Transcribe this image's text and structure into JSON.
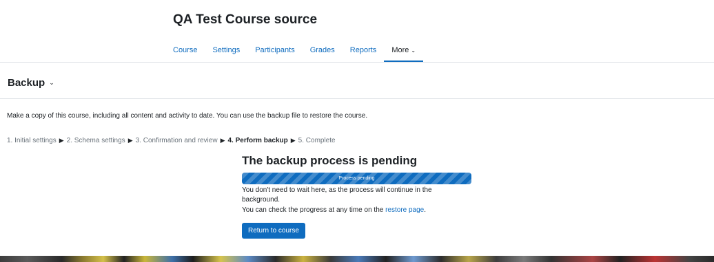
{
  "header": {
    "course_title": "QA Test Course source"
  },
  "nav": {
    "items": [
      {
        "label": "Course"
      },
      {
        "label": "Settings"
      },
      {
        "label": "Participants"
      },
      {
        "label": "Grades"
      },
      {
        "label": "Reports"
      },
      {
        "label": "More"
      }
    ],
    "active": "More"
  },
  "section": {
    "heading": "Backup"
  },
  "intro": "Make a copy of this course, including all content and activity to date. You can use the backup file to restore the course.",
  "steps": {
    "items": [
      "1. Initial settings",
      "2. Schema settings",
      "3. Confirmation and review",
      "4. Perform backup",
      "5. Complete"
    ],
    "current_index": 3,
    "separator": "▶"
  },
  "pending": {
    "title": "The backup process is pending",
    "bar_label": "Process pending",
    "bar_progress": 1.0,
    "message_line1": "You don't need to wait here, as the process will continue in the background.",
    "message_line2_prefix": "You can check the progress at any time on the ",
    "restore_link": "restore page",
    "message_line2_suffix": ".",
    "return_button": "Return to course"
  },
  "colors": {
    "accent": "#0f6cbf",
    "text": "#1d2125",
    "muted": "#6a737b",
    "divider": "#dee2e6"
  },
  "icons": {
    "nav_more": "chevron-down-icon",
    "section_heading": "chevron-down-icon",
    "step_separator": "triangle-right-icon"
  }
}
